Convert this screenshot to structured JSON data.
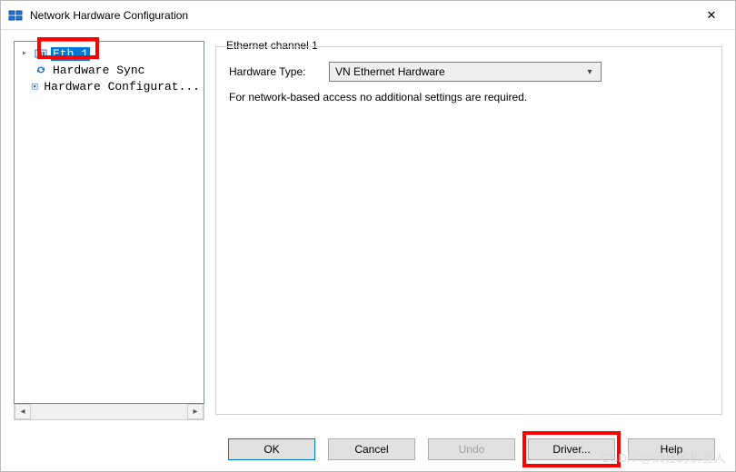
{
  "window": {
    "title": "Network Hardware Configuration",
    "close_glyph": "✕"
  },
  "tree": {
    "items": [
      {
        "label": "Eth 1",
        "selected": true
      },
      {
        "label": "Hardware Sync",
        "selected": false
      },
      {
        "label": "Hardware Configurat...",
        "selected": false
      }
    ]
  },
  "panel": {
    "group_title": "Ethernet channel 1",
    "hw_type_label": "Hardware Type:",
    "hw_type_value": "VN Ethernet Hardware",
    "info_text": "For network-based access no additional settings are required."
  },
  "buttons": {
    "ok": "OK",
    "cancel": "Cancel",
    "undo": "Undo",
    "driver": "Driver...",
    "help": "Help"
  },
  "watermark": "CSDN @疯狂的机器人"
}
